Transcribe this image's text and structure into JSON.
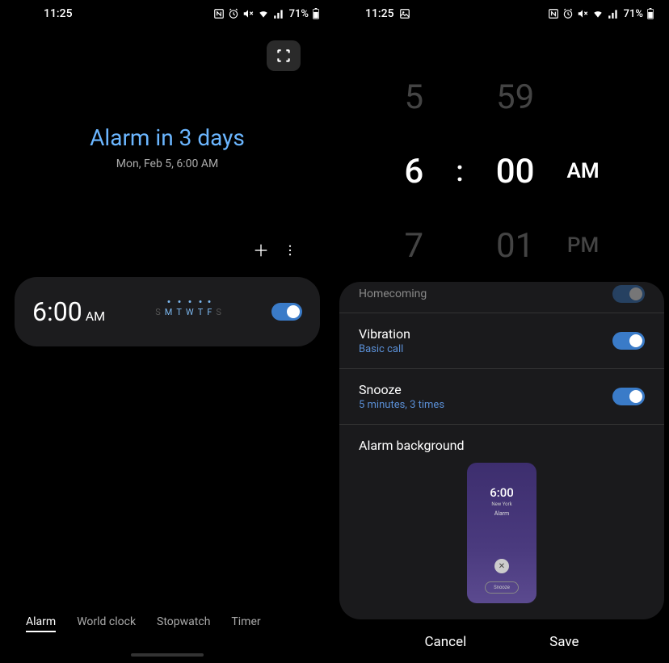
{
  "status": {
    "time": "11:25",
    "battery": "71%"
  },
  "left": {
    "header_title": "Alarm in 3 days",
    "header_subtitle": "Mon, Feb 5, 6:00 AM",
    "alarm": {
      "time": "6:00",
      "ampm": "AM",
      "days": [
        "S",
        "M",
        "T",
        "W",
        "T",
        "F",
        "S"
      ]
    },
    "tabs": {
      "alarm": "Alarm",
      "world_clock": "World clock",
      "stopwatch": "Stopwatch",
      "timer": "Timer"
    }
  },
  "right": {
    "picker": {
      "hour_prev": "5",
      "hour": "6",
      "hour_next": "7",
      "minute_prev": "59",
      "minute": "00",
      "minute_next": "01",
      "am": "AM",
      "pm": "PM",
      "sep": ":"
    },
    "sheet": {
      "partial_label": "Homecoming",
      "vibration_title": "Vibration",
      "vibration_sub": "Basic call",
      "snooze_title": "Snooze",
      "snooze_sub": "5 minutes, 3 times",
      "bg_title": "Alarm background",
      "preview_time": "6:00",
      "preview_sub": "New York",
      "preview_alarm": "Alarm",
      "preview_snooze": "Snooze"
    },
    "actions": {
      "cancel": "Cancel",
      "save": "Save"
    }
  }
}
